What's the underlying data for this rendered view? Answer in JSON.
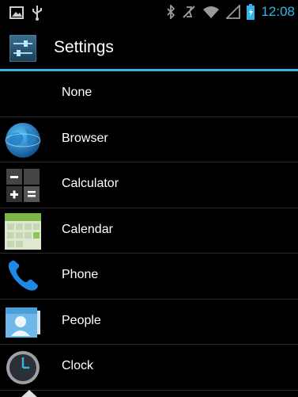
{
  "statusbar": {
    "left_icons": [
      "image-notification-icon",
      "usb-icon"
    ],
    "right_icons": [
      "bluetooth-icon",
      "mute-icon",
      "wifi-icon",
      "signal-icon",
      "battery-icon"
    ],
    "time": "12:08",
    "accent": "#33b5e5"
  },
  "actionbar": {
    "title": "Settings",
    "icon": "settings-sliders-icon"
  },
  "list": {
    "items": [
      {
        "label": "None",
        "icon": ""
      },
      {
        "label": "Browser",
        "icon": "globe-icon"
      },
      {
        "label": "Calculator",
        "icon": "calculator-icon"
      },
      {
        "label": "Calendar",
        "icon": "calendar-icon"
      },
      {
        "label": "Phone",
        "icon": "phone-icon"
      },
      {
        "label": "People",
        "icon": "people-icon"
      },
      {
        "label": "Clock",
        "icon": "clock-icon"
      }
    ]
  }
}
